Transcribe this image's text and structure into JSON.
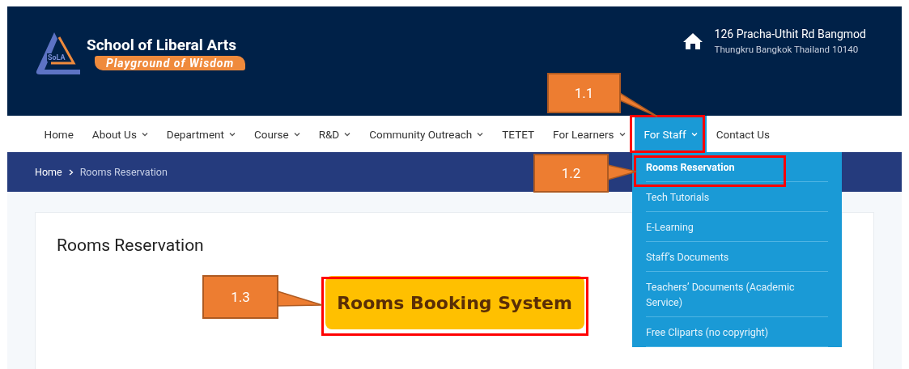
{
  "header": {
    "logo": {
      "mark": "SoLA",
      "title": "School of Liberal Arts",
      "tagline": "Playground of Wisdom"
    },
    "address": {
      "line1": "126 Pracha-Uthit Rd Bangmod",
      "line2": "Thungkru Bangkok Thailand 10140"
    }
  },
  "nav": [
    {
      "label": "Home",
      "dropdown": false,
      "selected": false
    },
    {
      "label": "About Us",
      "dropdown": true,
      "selected": false
    },
    {
      "label": "Department",
      "dropdown": true,
      "selected": false
    },
    {
      "label": "Course",
      "dropdown": true,
      "selected": false
    },
    {
      "label": "R&D",
      "dropdown": true,
      "selected": false
    },
    {
      "label": "Community Outreach",
      "dropdown": true,
      "selected": false
    },
    {
      "label": "TETET",
      "dropdown": false,
      "selected": false
    },
    {
      "label": "For Learners",
      "dropdown": true,
      "selected": false
    },
    {
      "label": "For Staff",
      "dropdown": true,
      "selected": true
    },
    {
      "label": "Contact Us",
      "dropdown": false,
      "selected": false
    }
  ],
  "dropdown": [
    "Rooms Reservation",
    "Tech Tutorials",
    "E-Learning",
    "Staff’s Documents",
    "Teachers’ Documents (Academic Service)",
    "Free Cliparts (no copyright)"
  ],
  "breadcrumb": [
    "Home",
    "Rooms Reservation"
  ],
  "page": {
    "title": "Rooms Reservation",
    "button": "Rooms Booking System"
  },
  "annotations": [
    "1.1",
    "1.2",
    "1.3"
  ]
}
